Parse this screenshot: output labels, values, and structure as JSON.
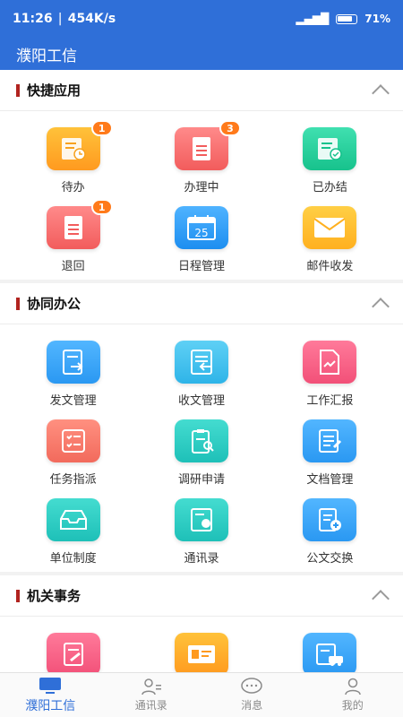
{
  "status": {
    "time": "11:26",
    "speed": "454K/s",
    "battery": "71",
    "battery_unit": "%"
  },
  "appbar": {
    "title": "濮阳工信"
  },
  "sections": [
    {
      "title": "快捷应用",
      "items": [
        {
          "label": "待办",
          "badge": "1",
          "icon": "todo-doc-clock-icon",
          "color": "orange"
        },
        {
          "label": "办理中",
          "badge": "3",
          "icon": "in-progress-doc-icon",
          "color": "red"
        },
        {
          "label": "已办结",
          "badge": "",
          "icon": "completed-doc-check-icon",
          "color": "green"
        },
        {
          "label": "退回",
          "badge": "1",
          "icon": "returned-doc-icon",
          "color": "red"
        },
        {
          "label": "日程管理",
          "badge": "",
          "icon": "calendar-icon",
          "color": "blue",
          "calendar_day": "25"
        },
        {
          "label": "邮件收发",
          "badge": "",
          "icon": "mail-envelope-icon",
          "color": "yellow"
        }
      ]
    },
    {
      "title": "协同办公",
      "items": [
        {
          "label": "发文管理",
          "icon": "outgoing-doc-icon",
          "color": "sky"
        },
        {
          "label": "收文管理",
          "icon": "incoming-doc-icon",
          "color": "cyan"
        },
        {
          "label": "工作汇报",
          "icon": "report-chart-icon",
          "color": "pink"
        },
        {
          "label": "任务指派",
          "icon": "task-list-icon",
          "color": "coral"
        },
        {
          "label": "调研申请",
          "icon": "research-clipboard-icon",
          "color": "teal"
        },
        {
          "label": "文档管理",
          "icon": "document-edit-icon",
          "color": "sky"
        },
        {
          "label": "单位制度",
          "icon": "inbox-tray-icon",
          "color": "teal"
        },
        {
          "label": "通讯录",
          "icon": "contact-card-icon",
          "color": "teal"
        },
        {
          "label": "公文交换",
          "icon": "doc-exchange-icon",
          "color": "sky"
        }
      ]
    },
    {
      "title": "机关事务",
      "items": [
        {
          "label": "",
          "icon": "edit-form-icon",
          "color": "pink"
        },
        {
          "label": "",
          "icon": "id-card-icon",
          "color": "orange"
        },
        {
          "label": "",
          "icon": "vehicle-doc-icon",
          "color": "sky"
        }
      ]
    }
  ],
  "tabs": [
    {
      "label": "濮阳工信",
      "icon": "monitor-icon",
      "active": true
    },
    {
      "label": "通讯录",
      "icon": "contacts-icon",
      "active": false
    },
    {
      "label": "消息",
      "icon": "chat-bubble-icon",
      "active": false
    },
    {
      "label": "我的",
      "icon": "user-icon",
      "active": false
    }
  ]
}
